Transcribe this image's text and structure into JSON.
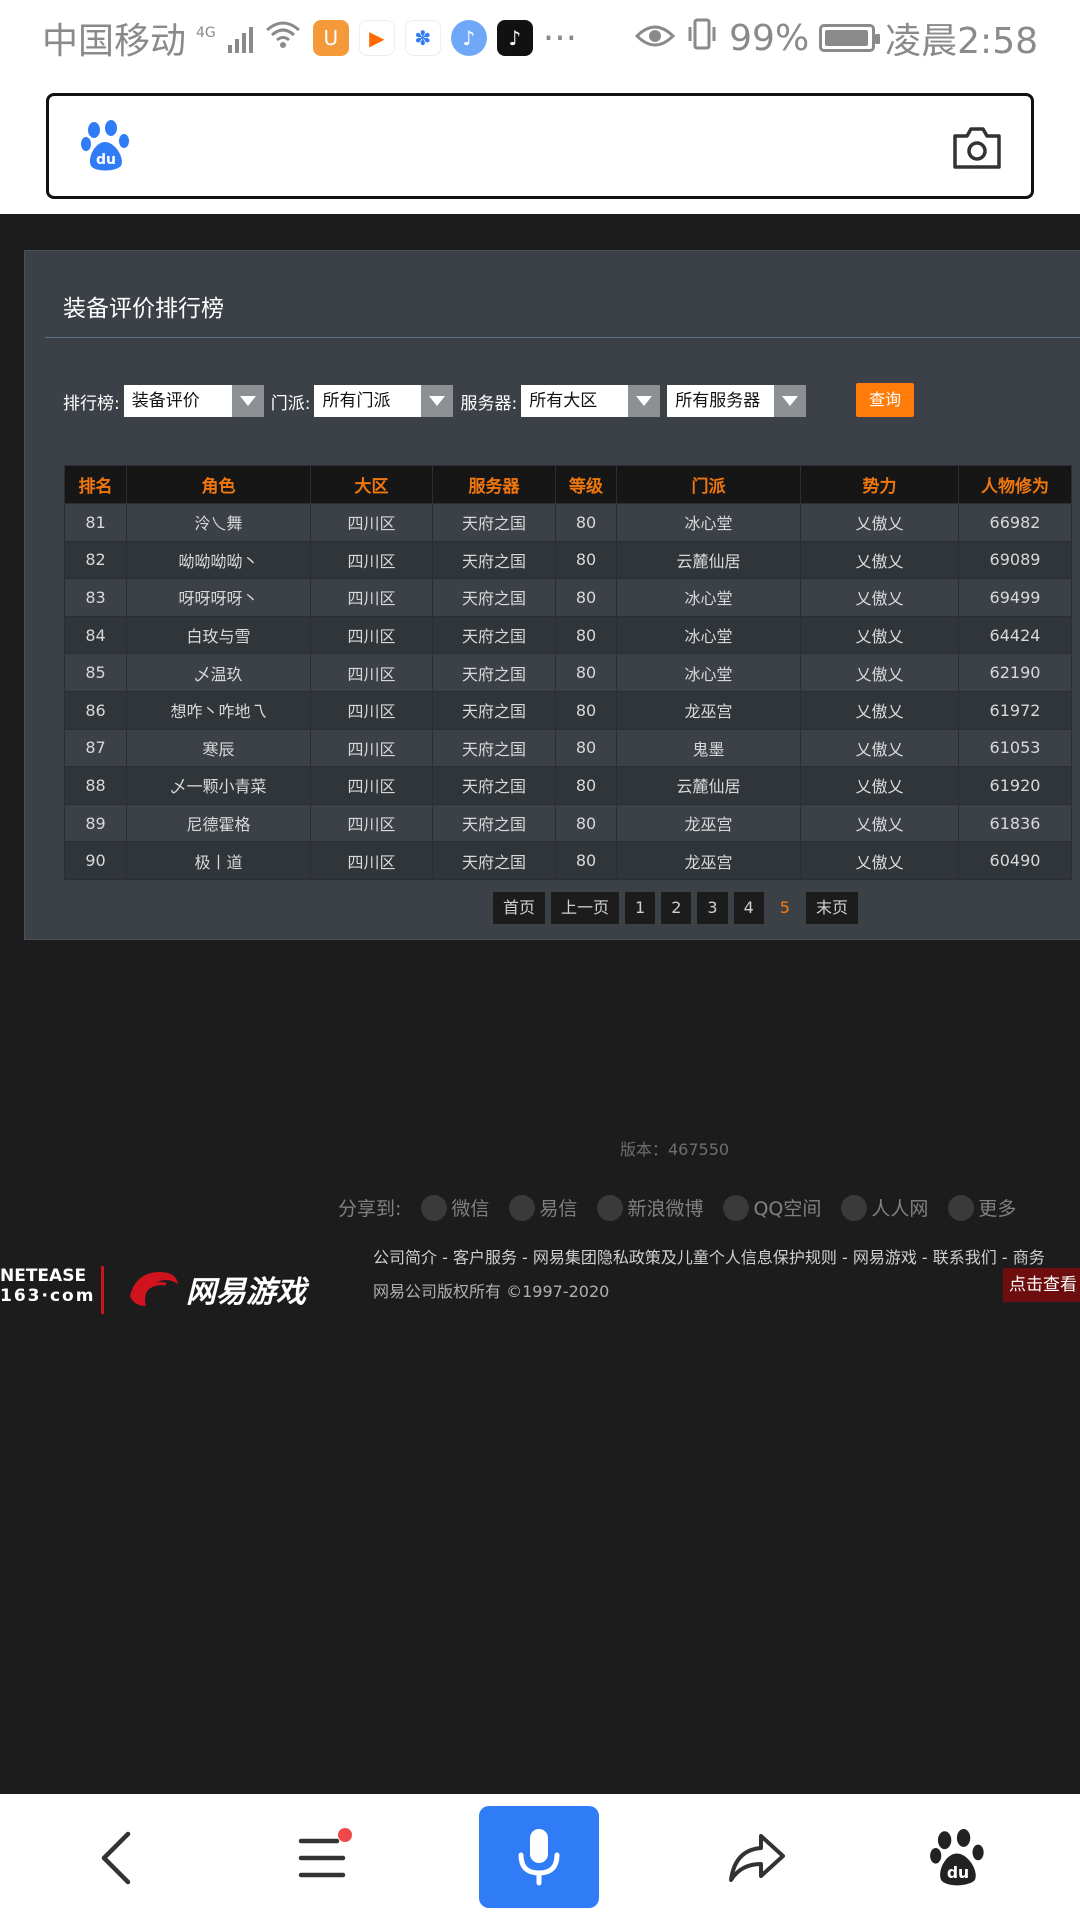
{
  "status_bar": {
    "carrier": "中国移动",
    "network": "4G",
    "battery": "99%",
    "time": "凌晨2:58",
    "more": "···"
  },
  "search": {
    "placeholder": ""
  },
  "page": {
    "title": "装备评价排行榜",
    "filters": {
      "rank_label": "排行榜:",
      "rank_value": "装备评价",
      "school_label": "门派:",
      "school_value": "所有门派",
      "server_label": "服务器:",
      "region_value": "所有大区",
      "server_value": "所有服务器",
      "query_button": "查询"
    },
    "table": {
      "headers": [
        "排名",
        "角色",
        "大区",
        "服务器",
        "等级",
        "门派",
        "势力",
        "人物修为"
      ],
      "rows": [
        [
          "81",
          "泠乀舞",
          "四川区",
          "天府之国",
          "80",
          "冰心堂",
          "乂傲乂",
          "66982"
        ],
        [
          "82",
          "呦呦呦呦丶",
          "四川区",
          "天府之国",
          "80",
          "云麓仙居",
          "乂傲乂",
          "69089"
        ],
        [
          "83",
          "呀呀呀呀丶",
          "四川区",
          "天府之国",
          "80",
          "冰心堂",
          "乂傲乂",
          "69499"
        ],
        [
          "84",
          "白玫与雪",
          "四川区",
          "天府之国",
          "80",
          "冰心堂",
          "乂傲乂",
          "64424"
        ],
        [
          "85",
          "乄温玖",
          "四川区",
          "天府之国",
          "80",
          "冰心堂",
          "乂傲乂",
          "62190"
        ],
        [
          "86",
          "想咋丶咋地乁",
          "四川区",
          "天府之国",
          "80",
          "龙巫宫",
          "乂傲乂",
          "61972"
        ],
        [
          "87",
          "寒辰",
          "四川区",
          "天府之国",
          "80",
          "鬼墨",
          "乂傲乂",
          "61053"
        ],
        [
          "88",
          "乄一颗小青菜",
          "四川区",
          "天府之国",
          "80",
          "云麓仙居",
          "乂傲乂",
          "61920"
        ],
        [
          "89",
          "尼德霍格",
          "四川区",
          "天府之国",
          "80",
          "龙巫宫",
          "乂傲乂",
          "61836"
        ],
        [
          "90",
          "极丨道",
          "四川区",
          "天府之国",
          "80",
          "龙巫宫",
          "乂傲乂",
          "60490"
        ]
      ]
    },
    "pagination": {
      "first": "首页",
      "prev": "上一页",
      "pages": [
        "1",
        "2",
        "3",
        "4",
        "5"
      ],
      "current": "5",
      "last": "末页"
    },
    "version": "版本：467550",
    "share": {
      "label": "分享到:",
      "targets": [
        "微信",
        "易信",
        "新浪微博",
        "QQ空间",
        "人人网",
        "更多"
      ]
    },
    "footer": {
      "netease_line1": "NETEASE",
      "netease_line2": "163·com",
      "game_brand": "网易游戏",
      "links": "公司简介 - 客户服务 - 网易集团隐私政策及儿童个人信息保护规则 - 网易游戏 - 联系我们 - 商务",
      "copyright": "网易公司版权所有 ©1997-2020",
      "click_see": "点击查看"
    }
  },
  "colors": {
    "accent": "#ff7c0a",
    "panel": "#3b4147",
    "page_bg": "#1c1c1d",
    "mic": "#2f7cf6"
  }
}
